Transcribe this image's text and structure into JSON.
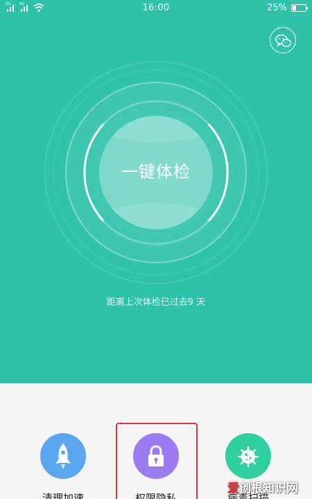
{
  "status_bar": {
    "signal_1_tag": "2G",
    "signal_2_tag": "4G",
    "time": "16:00",
    "battery": "25%",
    "battery_level": 0.25
  },
  "header": {
    "wechat_icon": "wechat-icon"
  },
  "checkup": {
    "button_label": "一键体检",
    "last_check_text": "距离上次体检已过去9 天"
  },
  "shortcuts": [
    {
      "label": "清理加速",
      "icon": "rocket-icon",
      "color": "#5aa6f0"
    },
    {
      "label": "权限隐私",
      "icon": "lock-icon",
      "color": "#9b7af2"
    },
    {
      "label": "病毒扫描",
      "icon": "virus-icon",
      "color": "#2fcf9f"
    }
  ],
  "watermark": {
    "accent": "爱",
    "rest": "创根知识网"
  },
  "colors": {
    "hero_bg": "#2ec2ab",
    "highlight": "#e0323a"
  }
}
